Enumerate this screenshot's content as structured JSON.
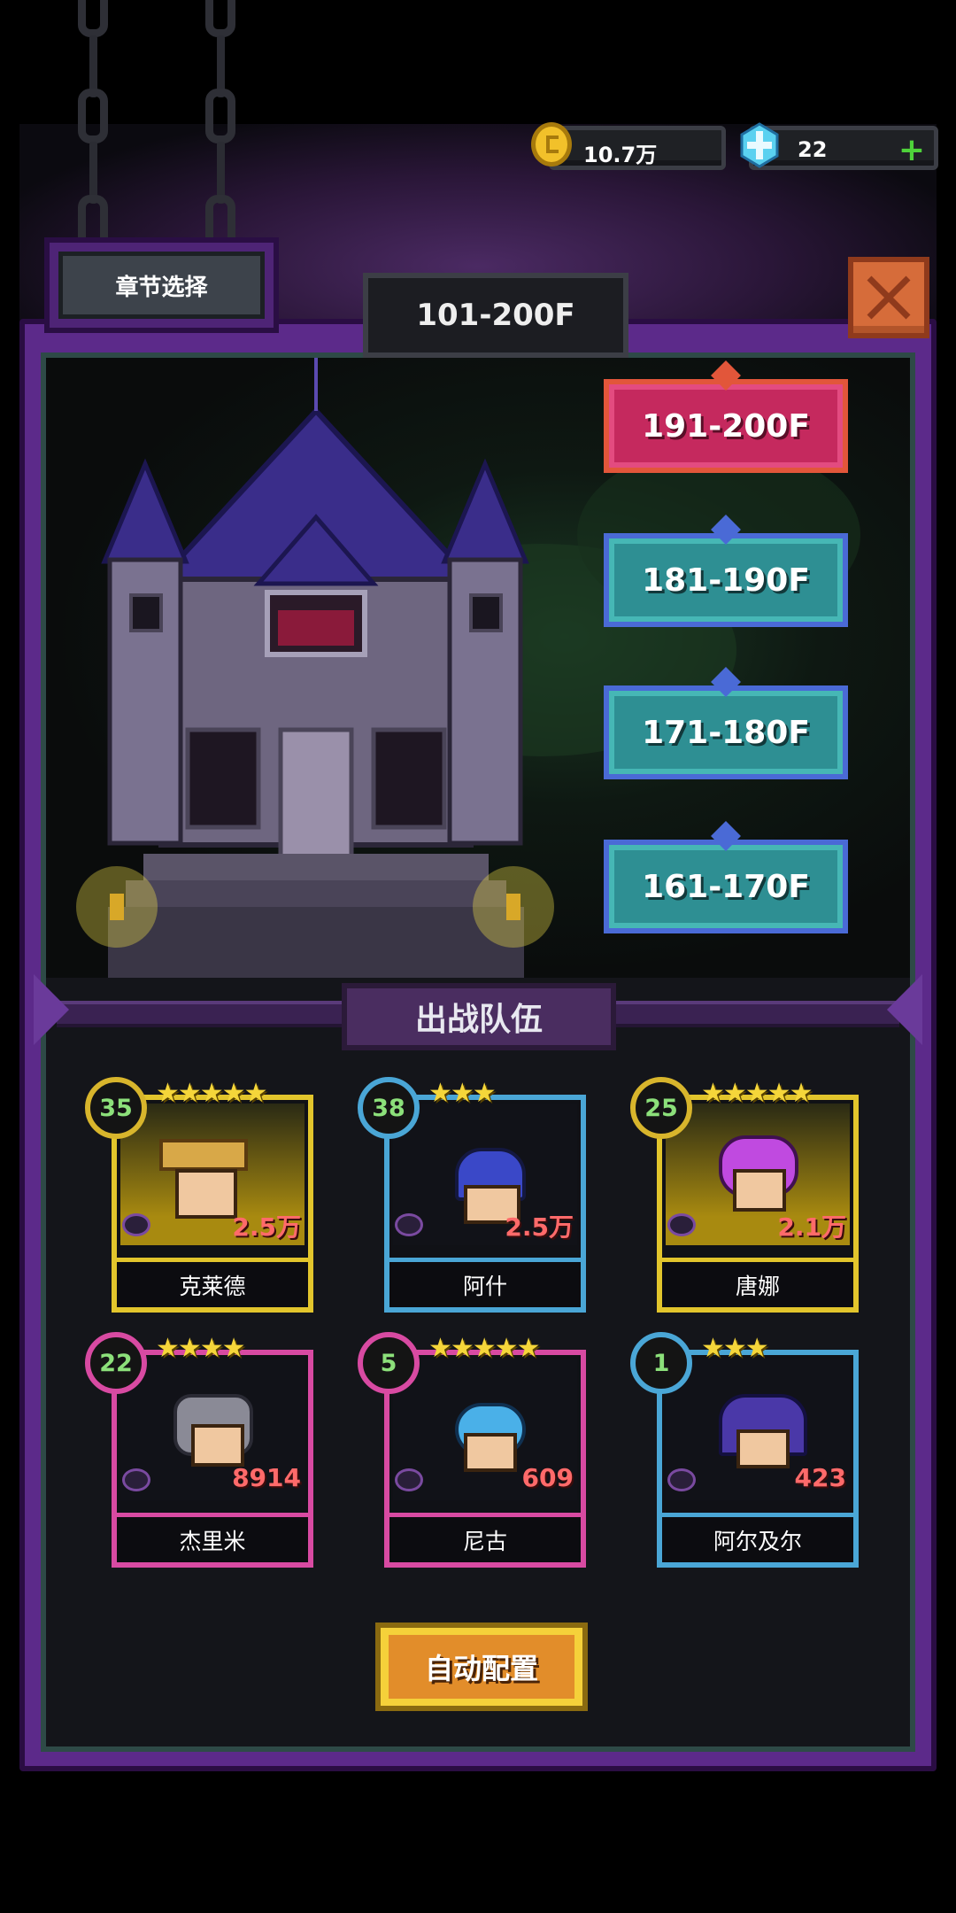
{
  "resources": {
    "gold": {
      "value": "10.7万",
      "icon": "gold-coin-icon"
    },
    "gems": {
      "value": "22",
      "icon": "diamond-gem-icon",
      "add": "+"
    }
  },
  "header": {
    "chapter_select": "章节选择",
    "current_range": "101-200F"
  },
  "floors": [
    {
      "label": "191-200F",
      "active": true
    },
    {
      "label": "181-190F",
      "active": false
    },
    {
      "label": "171-180F",
      "active": false
    },
    {
      "label": "161-170F",
      "active": false
    }
  ],
  "team": {
    "title": "出战队伍",
    "heroes": [
      {
        "name": "克莱德",
        "level": "35",
        "stars": "★★★★★",
        "power": "2.5万",
        "rarity": "gold"
      },
      {
        "name": "阿什",
        "level": "38",
        "stars": "★★★",
        "power": "2.5万",
        "rarity": "blue"
      },
      {
        "name": "唐娜",
        "level": "25",
        "stars": "★★★★★",
        "power": "2.1万",
        "rarity": "gold"
      },
      {
        "name": "杰里米",
        "level": "22",
        "stars": "★★★★",
        "power": "8914",
        "rarity": "pink"
      },
      {
        "name": "尼古",
        "level": "5",
        "stars": "★★★★★",
        "power": "609",
        "rarity": "pink"
      },
      {
        "name": "阿尔及尔",
        "level": "1",
        "stars": "★★★",
        "power": "423",
        "rarity": "blue"
      }
    ]
  },
  "auto_config": "自动配置",
  "colors": {
    "active_floor": "#c5295e",
    "floor": "#2e8f93",
    "gold": "#e2c52c",
    "blue": "#4aa6d6",
    "pink": "#d84aa2",
    "panel": "#5c2a8a"
  }
}
